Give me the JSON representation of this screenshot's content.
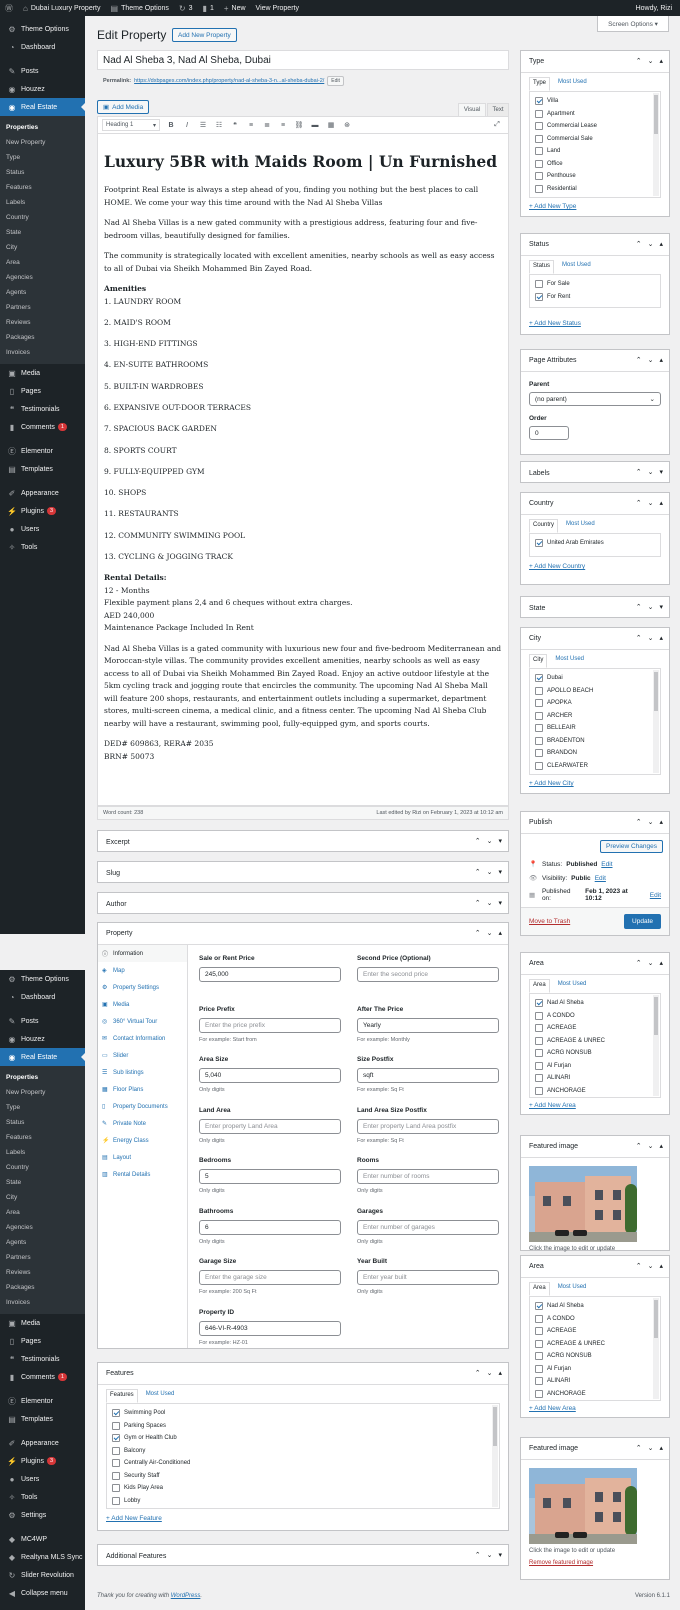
{
  "adminbar": {
    "site": "Dubai Luxury Property",
    "theme_options": "Theme Options",
    "updates": "3",
    "comments": "1",
    "new": "New",
    "view": "View Property",
    "howdy": "Howdy, Rizi"
  },
  "menu": {
    "items_top": [
      "Theme Options",
      "Dashboard",
      "Posts",
      "Houzez",
      "Real Estate"
    ],
    "sub": [
      "Properties",
      "New Property",
      "Type",
      "Status",
      "Features",
      "Labels",
      "Country",
      "State",
      "City",
      "Area",
      "Agencies",
      "Agents",
      "Partners",
      "Reviews",
      "Packages",
      "Invoices"
    ],
    "items_mid": [
      "Media",
      "Pages",
      "Testimonials",
      "Comments"
    ],
    "comments_badge": "1",
    "items_low": [
      "Elementor",
      "Templates",
      "Appearance",
      "Plugins",
      "Users",
      "Tools"
    ],
    "plugins_badge": "3",
    "extra": [
      "Settings",
      "MC4WP",
      "Realtyna MLS Sync",
      "Slider Revolution",
      "Collapse menu"
    ]
  },
  "screen_options": "Screen Options ▾",
  "page_title": "Edit Property",
  "add_new": "Add New Property",
  "post_title": "Nad Al Sheba 3, Nad Al Sheba, Dubai",
  "permalink": {
    "label": "Permalink:",
    "url": "https://dxbpages.com/index.php/property/nad-al-sheba-3-n...al-sheba-dubai-2/",
    "edit": "Edit"
  },
  "editor": {
    "add_media": "Add Media",
    "tab_visual": "Visual",
    "tab_text": "Text",
    "format": "Heading 1",
    "heading": "Luxury 5BR with Maids Room | Un Furnished",
    "intro": "Footprint Real Estate is always a step ahead of you, finding you nothing but the best places to call HOME. We come your way this time around with the Nad Al Sheba Villas",
    "p2": "Nad Al Sheba Villas is a new gated community with a prestigious address, featuring four and five-bedroom villas, beautifully designed for families.",
    "p3": "The community is strategically located with excellent amenities, nearby schools as well as easy access to all of Dubai via Sheikh Mohammed Bin Zayed Road.",
    "amenities_title": "Amenities",
    "amenities": [
      "1. LAUNDRY ROOM",
      "2. MAID'S ROOM",
      "3. HIGH-END FITTINGS",
      "4. EN-SUITE BATHROOMS",
      "5. BUILT-IN WARDROBES",
      "6. EXPANSIVE OUT-DOOR TERRACES",
      "7. SPACIOUS BACK GARDEN",
      "8. SPORTS COURT",
      "9. FULLY-EQUIPPED GYM",
      "10. SHOPS",
      "11. RESTAURANTS",
      "12. COMMUNITY SWIMMING POOL",
      "13. CYCLING & JOGGING TRACK"
    ],
    "rental_title": "Rental Details:",
    "rental": [
      "12 - Months",
      "Flexible payment plans 2,4 and 6 cheques without extra charges.",
      "AED 240,000",
      "Maintenance Package Included In Rent"
    ],
    "p_last": "Nad Al Sheba Villas is a gated community with luxurious new four and five-bedroom Mediterranean and Moroccan-style villas. The community provides excellent amenities, nearby schools as well as easy access to all of Dubai via Sheikh Mohammed Bin Zayed Road. Enjoy an active outdoor lifestyle at the 5km cycling track and jogging route that encircles the community. The upcoming Nad Al Sheba Mall will feature 200 shops, restaurants, and entertainment outlets including a supermarket, department stores, multi-screen cinema, a medical clinic, and a fitness center. The upcoming Nad Al Sheba Club nearby will have a restaurant, swimming pool, fully-equipped gym, and sports courts.",
    "ded": "DED# 609863, RERA# 2035",
    "brn": "BRN# 50073",
    "word_count": "Word count: 238",
    "last_edited": "Last edited by Rizi on February 1, 2023 at 10:12 am"
  },
  "boxes": {
    "excerpt": "Excerpt",
    "slug": "Slug",
    "author": "Author",
    "property": "Property",
    "features": "Features",
    "additional": "Additional Features"
  },
  "property": {
    "nav": [
      "Information",
      "Map",
      "Property Settings",
      "Media",
      "360° Virtual Tour",
      "Contact Information",
      "Slider",
      "Sub listings",
      "Floor Plans",
      "Property Documents",
      "Private Note",
      "Energy Class",
      "Layout",
      "Rental Details"
    ],
    "fields": [
      {
        "label": "Sale or Rent Price",
        "value": "245,000",
        "ph": "",
        "hint": ""
      },
      {
        "label": "Second Price (Optional)",
        "value": "",
        "ph": "Enter the second price",
        "hint": ""
      },
      {
        "label": "Price Prefix",
        "value": "",
        "ph": "Enter the price prefix",
        "hint": "For example: Start from"
      },
      {
        "label": "After The Price",
        "value": "Yearly",
        "ph": "",
        "hint": "For example: Monthly"
      },
      {
        "label": "Area Size",
        "value": "5,040",
        "ph": "",
        "hint": "Only digits"
      },
      {
        "label": "Size Postfix",
        "value": "sqft",
        "ph": "",
        "hint": "For example: Sq Ft"
      },
      {
        "label": "Land Area",
        "value": "",
        "ph": "Enter property Land Area",
        "hint": "Only digits"
      },
      {
        "label": "Land Area Size Postfix",
        "value": "",
        "ph": "Enter property Land Area postfix",
        "hint": "For example: Sq Ft"
      },
      {
        "label": "Bedrooms",
        "value": "5",
        "ph": "",
        "hint": "Only digits"
      },
      {
        "label": "Rooms",
        "value": "",
        "ph": "Enter number of rooms",
        "hint": "Only digits"
      },
      {
        "label": "Bathrooms",
        "value": "6",
        "ph": "",
        "hint": "Only digits"
      },
      {
        "label": "Garages",
        "value": "",
        "ph": "Enter number of garages",
        "hint": "Only digits"
      },
      {
        "label": "Garage Size",
        "value": "",
        "ph": "Enter the garage size",
        "hint": "For example: 200 Sq Ft"
      },
      {
        "label": "Year Built",
        "value": "",
        "ph": "Enter year built",
        "hint": "Only digits"
      },
      {
        "label": "Property ID",
        "value": "646-VI-R-4903",
        "ph": "",
        "hint": "For example: HZ-01"
      }
    ]
  },
  "features": {
    "tab1": "Features",
    "tab2": "Most Used",
    "items": [
      "Swimming Pool",
      "Parking Spaces",
      "Gym or Health Club",
      "Balcony",
      "Centrally Air-Conditioned",
      "Security Staff",
      "Kids Play Area",
      "Lobby"
    ],
    "checked": [
      true,
      false,
      true,
      false,
      false,
      false,
      false,
      false
    ],
    "add": "+ Add New Feature"
  },
  "type_box": {
    "title": "Type",
    "tab1": "Type",
    "tab2": "Most Used",
    "items": [
      "Villa",
      "Apartment",
      "Commercial Lease",
      "Commercial Sale",
      "Land",
      "Office",
      "Penthouse",
      "Residential"
    ],
    "checked": [
      true,
      false,
      false,
      false,
      false,
      false,
      false,
      false
    ],
    "add": "+ Add New Type"
  },
  "status_box": {
    "title": "Status",
    "tab1": "Status",
    "tab2": "Most Used",
    "items": [
      "For Sale",
      "For Rent"
    ],
    "checked": [
      false,
      true
    ],
    "add": "+ Add New Status"
  },
  "page_attr": {
    "title": "Page Attributes",
    "parent_label": "Parent",
    "parent_value": "(no parent)",
    "order_label": "Order",
    "order_value": "0"
  },
  "labels_box": {
    "title": "Labels"
  },
  "country_box": {
    "title": "Country",
    "tab1": "Country",
    "tab2": "Most Used",
    "items": [
      "United Arab Emirates"
    ],
    "checked": [
      true
    ],
    "add": "+ Add New Country"
  },
  "state_box": {
    "title": "State"
  },
  "city_box": {
    "title": "City",
    "tab1": "City",
    "tab2": "Most Used",
    "items": [
      "Dubai",
      "APOLLO BEACH",
      "APOPKA",
      "ARCHER",
      "BELLEAIR",
      "BRADENTON",
      "BRANDON",
      "CLEARWATER"
    ],
    "checked": [
      true,
      false,
      false,
      false,
      false,
      false,
      false,
      false
    ],
    "add": "+ Add New City"
  },
  "publish": {
    "title": "Publish",
    "preview": "Preview Changes",
    "status_label": "Status:",
    "status_value": "Published",
    "visibility_label": "Visibility:",
    "visibility_value": "Public",
    "published_label": "Published on:",
    "published_value": "Feb 1, 2023 at 10:12",
    "edit": "Edit",
    "trash": "Move to Trash",
    "update": "Update"
  },
  "area_box": {
    "title": "Area",
    "tab1": "Area",
    "tab2": "Most Used",
    "items": [
      "Nad Al Sheba",
      "A CONDO",
      "ACREAGE",
      "ACREAGE & UNREC",
      "ACRG NONSUB",
      "Al Furjan",
      "ALINARI",
      "ANCHORAGE"
    ],
    "checked": [
      true,
      false,
      false,
      false,
      false,
      false,
      false,
      false
    ],
    "add": "+ Add New Area"
  },
  "featured": {
    "title": "Featured image",
    "caption": "Click the image to edit or update",
    "remove": "Remove featured image"
  },
  "footer": {
    "thanks": "Thank you for creating with",
    "wp": "WordPress",
    "version": "Version 6.1.1"
  }
}
